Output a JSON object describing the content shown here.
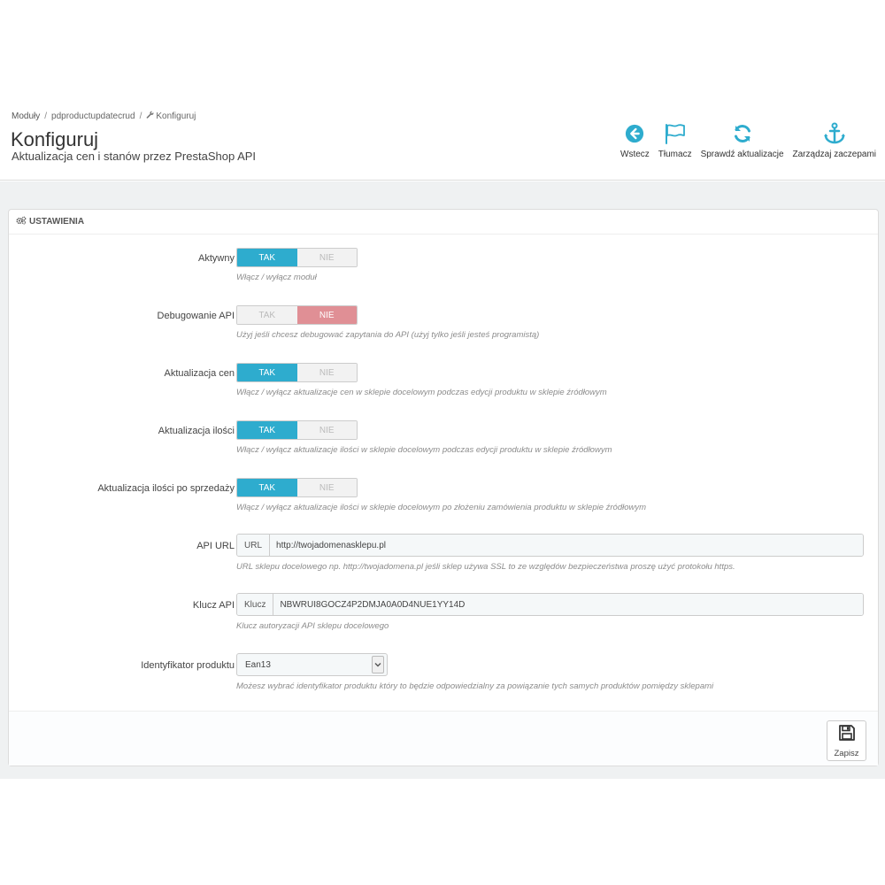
{
  "breadcrumb": {
    "items": [
      "Moduły",
      "pdproductupdatecrud",
      "Konfiguruj"
    ]
  },
  "header": {
    "title": "Konfiguruj",
    "subtitle": "Aktualizacja cen i stanów przez PrestaShop API"
  },
  "toolbar": {
    "back": {
      "label": "Wstecz",
      "icon": "arrow-left-circle-icon"
    },
    "translate": {
      "label": "Tłumacz",
      "icon": "flag-icon"
    },
    "check_updates": {
      "label": "Sprawdź aktualizacje",
      "icon": "refresh-icon"
    },
    "hooks": {
      "label": "Zarządzaj zaczepami",
      "icon": "anchor-icon"
    }
  },
  "panel": {
    "title": "USTAWIENIA",
    "icon": "gears-icon"
  },
  "switch_labels": {
    "yes": "TAK",
    "no": "NIE"
  },
  "fields": {
    "active": {
      "label": "Aktywny",
      "value": "yes",
      "help": "Włącz / wyłącz moduł"
    },
    "debug": {
      "label": "Debugowanie API",
      "value": "no",
      "help": "Użyj jeśli chcesz debugować zapytania do API (użyj tylko jeśli jesteś programistą)"
    },
    "price_update": {
      "label": "Aktualizacja cen",
      "value": "yes",
      "help": "Włącz / wyłącz aktualizacje cen w sklepie docelowym podczas edycji produktu w sklepie źródłowym"
    },
    "qty_update": {
      "label": "Aktualizacja ilości",
      "value": "yes",
      "help": "Włącz / wyłącz aktualizacje ilości w sklepie docelowym podczas edycji produktu w sklepie źródłowym"
    },
    "qty_after_sale": {
      "label": "Aktualizacja ilości po sprzedaży",
      "value": "yes",
      "help": "Włącz / wyłącz aktualizacje ilości w sklepie docelowym po złożeniu zamówienia produktu w sklepie źródłowym"
    },
    "api_url": {
      "label": "API URL",
      "addon": "URL",
      "value": "http://twojadomenasklepu.pl",
      "help": "URL sklepu docelowego np. http://twojadomena.pl jeśli sklep używa SSL to ze względów bezpieczeństwa proszę użyć protokołu https."
    },
    "api_key": {
      "label": "Klucz API",
      "addon": "Klucz",
      "value": "NBWRUI8GOCZ4P2DMJA0A0D4NUE1YY14D",
      "help": "Klucz autoryzacji API sklepu docelowego"
    },
    "product_id": {
      "label": "Identyfikator produktu",
      "value": "Ean13",
      "help": "Możesz wybrać identyfikator produktu który to będzie odpowiedzialny za powiązanie tych samych produktów pomiędzy sklepami"
    }
  },
  "footer": {
    "save_label": "Zapisz",
    "save_icon": "floppy-disk-icon"
  },
  "colors": {
    "accent": "#2eacce",
    "no_active": "#e08f95",
    "background": "#eff1f2"
  }
}
